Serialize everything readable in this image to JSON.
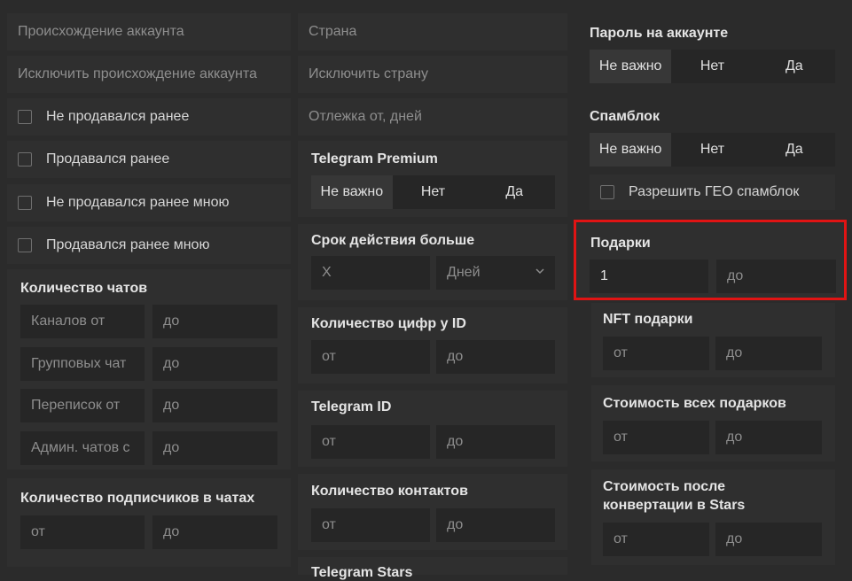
{
  "left": {
    "origin_placeholder": "Происхождение аккаунта",
    "exclude_origin_placeholder": "Исключить происхождение аккаунта",
    "checks": [
      "Не продавался ранее",
      "Продавался ранее",
      "Не продавался ранее мною",
      "Продавался ранее мною"
    ],
    "chats_heading": "Количество чатов",
    "chat_rows": [
      {
        "from": "Каналов от",
        "to": "до"
      },
      {
        "from": "Групповых чат",
        "to": "до"
      },
      {
        "from": "Переписок от",
        "to": "до"
      },
      {
        "from": "Админ. чатов с",
        "to": "до"
      }
    ],
    "subscribers_heading": "Количество подписчиков в чатах",
    "subscribers_from": "от",
    "subscribers_to": "до"
  },
  "middle": {
    "country_placeholder": "Страна",
    "exclude_country_placeholder": "Исключить страну",
    "rest_placeholder": "Отлежка от, дней",
    "premium_heading": "Telegram Premium",
    "premium_options": [
      "Не важно",
      "Нет",
      "Да"
    ],
    "expiry_heading": "Срок действия больше",
    "expiry_value_placeholder": "X",
    "expiry_unit": "Дней",
    "id_digits_heading": "Количество цифр у ID",
    "id_digits_from": "от",
    "id_digits_to": "до",
    "tgid_heading": "Telegram ID",
    "tgid_from": "от",
    "tgid_to": "до",
    "contacts_heading": "Количество контактов",
    "contacts_from": "от",
    "contacts_to": "до",
    "partial_heading": "Telegram Stars"
  },
  "right": {
    "password_heading": "Пароль на аккаунте",
    "password_options": [
      "Не важно",
      "Нет",
      "Да"
    ],
    "spamblock_heading": "Спамблок",
    "spamblock_options": [
      "Не важно",
      "Нет",
      "Да"
    ],
    "geo_spamblock_label": "Разрешить ГЕО спамблок",
    "gifts_heading": "Подарки",
    "gifts_from_value": "1",
    "gifts_to": "до",
    "nft_heading": "NFT подарки",
    "nft_from": "от",
    "nft_to": "до",
    "gifts_cost_heading": "Стоимость всех подарков",
    "gifts_cost_from": "от",
    "gifts_cost_to": "до",
    "stars_cost_heading_line1": "Стоимость после",
    "stars_cost_heading_line2": "конвертации в Stars",
    "stars_cost_from": "от",
    "stars_cost_to": "до"
  },
  "colors": {
    "highlight": "#e01414",
    "background": "#2b2b2b"
  }
}
